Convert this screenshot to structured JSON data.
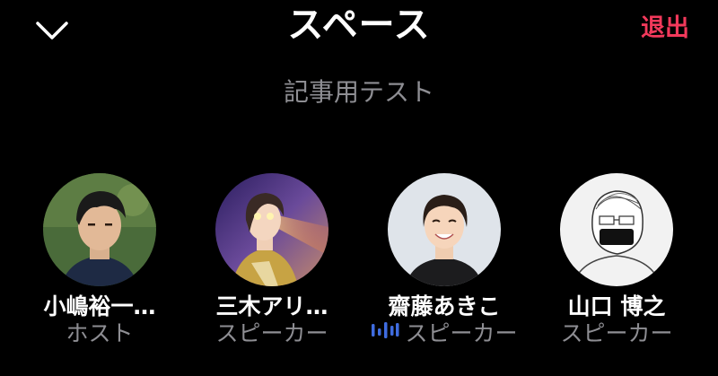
{
  "header": {
    "title": "スペース",
    "leave_label": "退出",
    "collapse_icon": "chevron-down-icon"
  },
  "space": {
    "name": "記事用テスト"
  },
  "participants": [
    {
      "name": "小嶋裕一…",
      "role": "ホスト",
      "speaking": false
    },
    {
      "name": "三木アリ…",
      "role": "スピーカー",
      "speaking": false
    },
    {
      "name": "齋藤あきこ",
      "role": "スピーカー",
      "speaking": true,
      "speaking_icon": "audio-wave-icon"
    },
    {
      "name": "山口 博之",
      "role": "スピーカー",
      "speaking": false
    }
  ],
  "colors": {
    "background": "#000000",
    "text": "#ffffff",
    "secondary_text": "#8e8e93",
    "leave": "#f2395b",
    "speaking_accent": "#3f6ce0"
  }
}
